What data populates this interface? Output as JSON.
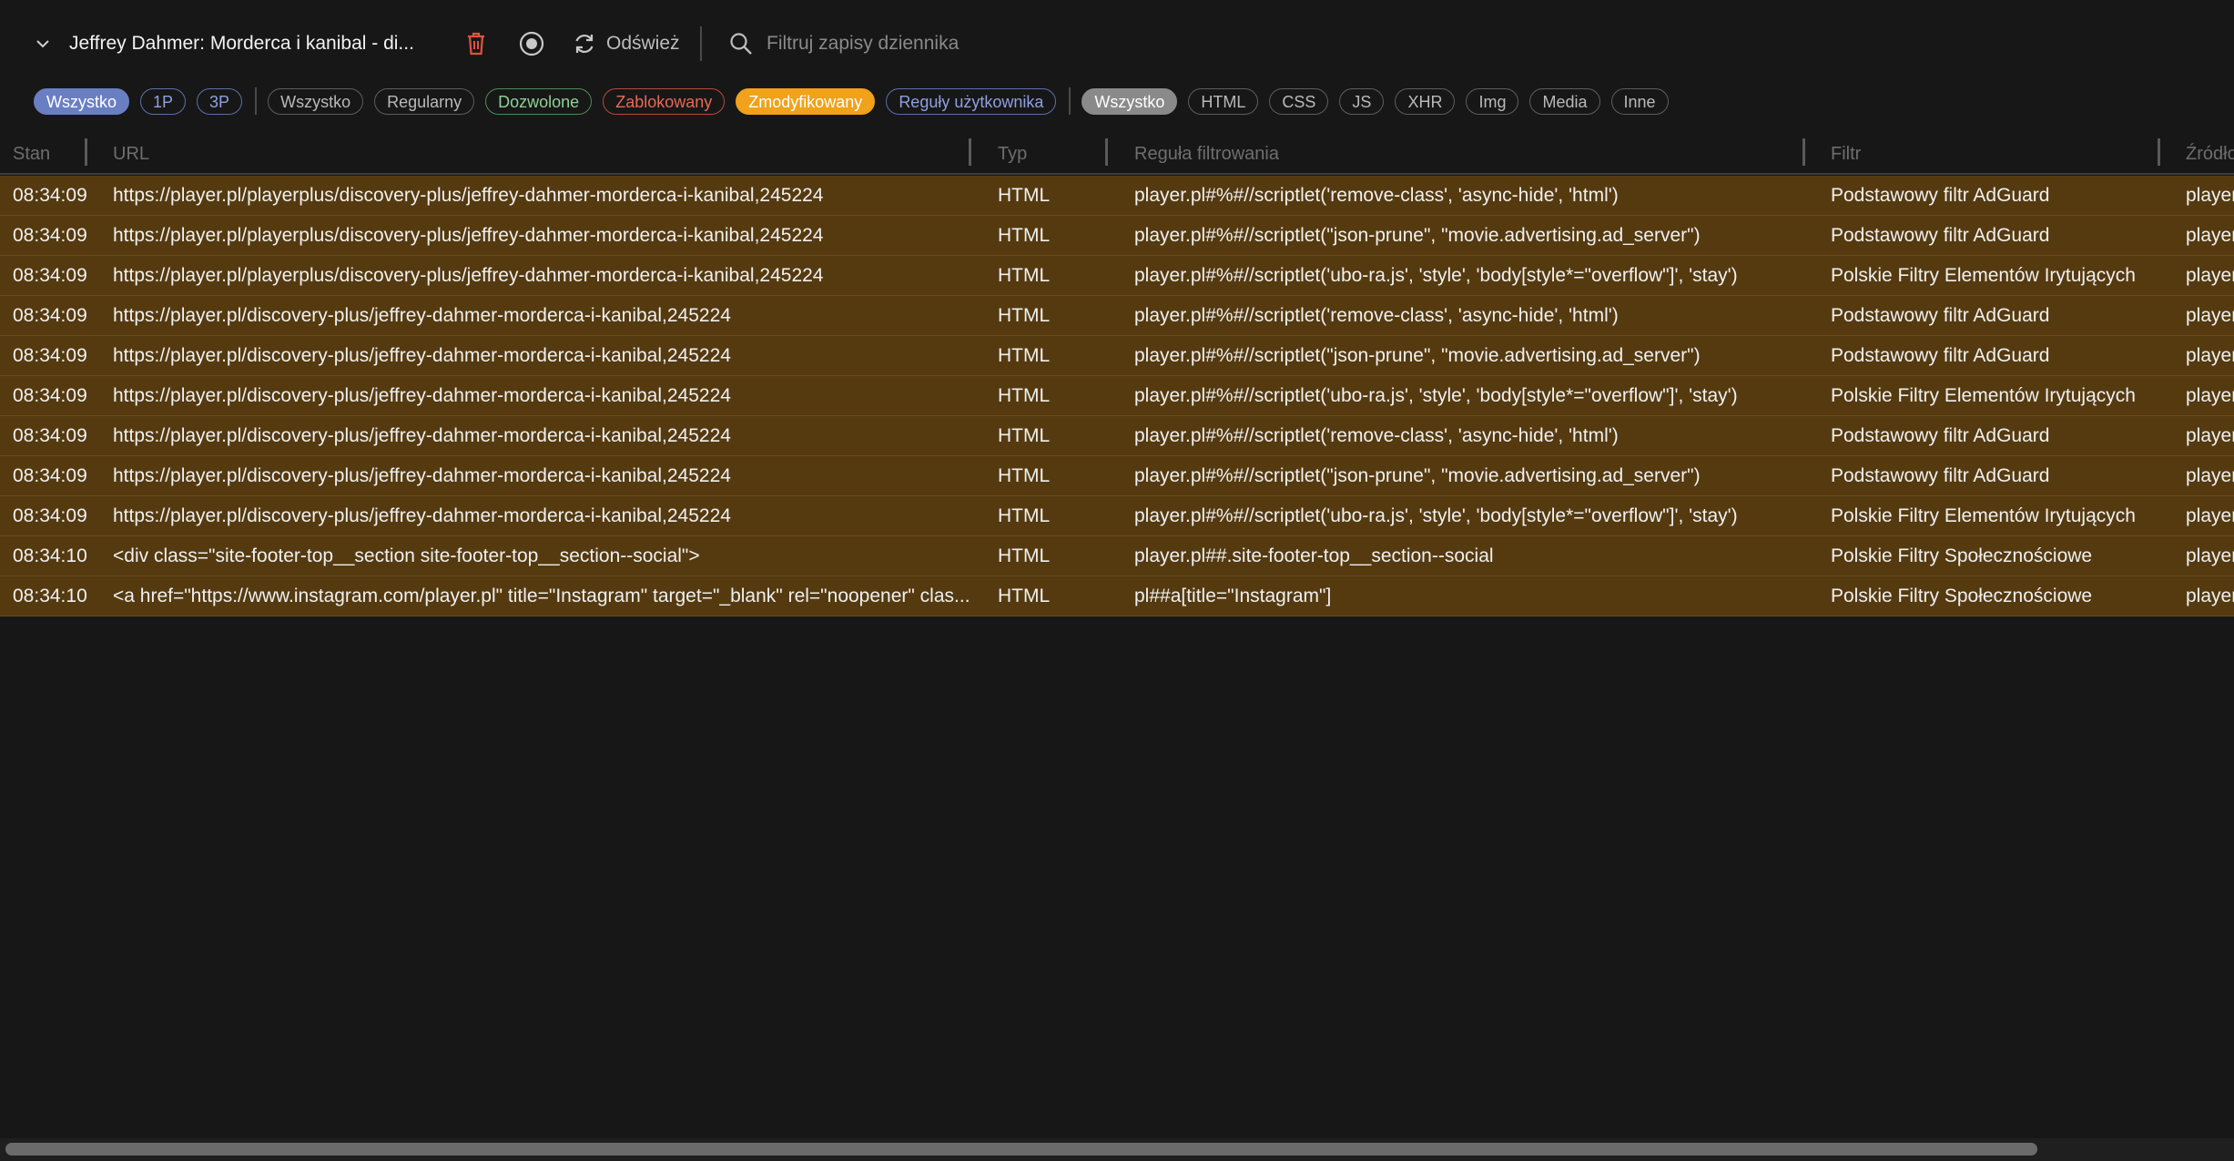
{
  "toolbar": {
    "tab_title": "Jeffrey Dahmer: Morderca i kanibal - di...",
    "refresh_label": "Odśwież",
    "search_placeholder": "Filtruj zapisy dziennika"
  },
  "chips": {
    "party": [
      {
        "label": "Wszystko",
        "active": true
      },
      {
        "label": "1P",
        "active": false
      },
      {
        "label": "3P",
        "active": false
      }
    ],
    "status": [
      {
        "label": "Wszystko",
        "active": false
      },
      {
        "label": "Regularny",
        "active": false
      },
      {
        "label": "Dozwolone",
        "active": false
      },
      {
        "label": "Zablokowany",
        "active": false
      },
      {
        "label": "Zmodyfikowany",
        "active": true
      },
      {
        "label": "Reguły użytkownika",
        "active": false
      }
    ],
    "type": [
      {
        "label": "Wszystko",
        "active": true
      },
      {
        "label": "HTML",
        "active": false
      },
      {
        "label": "CSS",
        "active": false
      },
      {
        "label": "JS",
        "active": false
      },
      {
        "label": "XHR",
        "active": false
      },
      {
        "label": "Img",
        "active": false
      },
      {
        "label": "Media",
        "active": false
      },
      {
        "label": "Inne",
        "active": false
      }
    ]
  },
  "table": {
    "headers": {
      "time": "Stan",
      "url": "URL",
      "type": "Typ",
      "rule": "Reguła filtrowania",
      "filter": "Filtr",
      "source": "Źródło"
    },
    "rows": [
      {
        "time": "08:34:09",
        "url": "https://player.pl/playerplus/discovery-plus/jeffrey-dahmer-morderca-i-kanibal,245224",
        "type": "HTML",
        "rule": "player.pl#%#//scriptlet('remove-class', 'async-hide', 'html')",
        "filter": "Podstawowy filtr AdGuard",
        "source": "player.pl"
      },
      {
        "time": "08:34:09",
        "url": "https://player.pl/playerplus/discovery-plus/jeffrey-dahmer-morderca-i-kanibal,245224",
        "type": "HTML",
        "rule": "player.pl#%#//scriptlet(\"json-prune\", \"movie.advertising.ad_server\")",
        "filter": "Podstawowy filtr AdGuard",
        "source": "player.pl"
      },
      {
        "time": "08:34:09",
        "url": "https://player.pl/playerplus/discovery-plus/jeffrey-dahmer-morderca-i-kanibal,245224",
        "type": "HTML",
        "rule": "player.pl#%#//scriptlet('ubo-ra.js', 'style', 'body[style*=\"overflow\"]', 'stay')",
        "filter": "Polskie Filtry Elementów Irytujących",
        "source": "player.pl"
      },
      {
        "time": "08:34:09",
        "url": "https://player.pl/discovery-plus/jeffrey-dahmer-morderca-i-kanibal,245224",
        "type": "HTML",
        "rule": "player.pl#%#//scriptlet('remove-class', 'async-hide', 'html')",
        "filter": "Podstawowy filtr AdGuard",
        "source": "player.pl"
      },
      {
        "time": "08:34:09",
        "url": "https://player.pl/discovery-plus/jeffrey-dahmer-morderca-i-kanibal,245224",
        "type": "HTML",
        "rule": "player.pl#%#//scriptlet(\"json-prune\", \"movie.advertising.ad_server\")",
        "filter": "Podstawowy filtr AdGuard",
        "source": "player.pl"
      },
      {
        "time": "08:34:09",
        "url": "https://player.pl/discovery-plus/jeffrey-dahmer-morderca-i-kanibal,245224",
        "type": "HTML",
        "rule": "player.pl#%#//scriptlet('ubo-ra.js', 'style', 'body[style*=\"overflow\"]', 'stay')",
        "filter": "Polskie Filtry Elementów Irytujących",
        "source": "player.pl"
      },
      {
        "time": "08:34:09",
        "url": "https://player.pl/discovery-plus/jeffrey-dahmer-morderca-i-kanibal,245224",
        "type": "HTML",
        "rule": "player.pl#%#//scriptlet('remove-class', 'async-hide', 'html')",
        "filter": "Podstawowy filtr AdGuard",
        "source": "player.pl"
      },
      {
        "time": "08:34:09",
        "url": "https://player.pl/discovery-plus/jeffrey-dahmer-morderca-i-kanibal,245224",
        "type": "HTML",
        "rule": "player.pl#%#//scriptlet(\"json-prune\", \"movie.advertising.ad_server\")",
        "filter": "Podstawowy filtr AdGuard",
        "source": "player.pl"
      },
      {
        "time": "08:34:09",
        "url": "https://player.pl/discovery-plus/jeffrey-dahmer-morderca-i-kanibal,245224",
        "type": "HTML",
        "rule": "player.pl#%#//scriptlet('ubo-ra.js', 'style', 'body[style*=\"overflow\"]', 'stay')",
        "filter": "Polskie Filtry Elementów Irytujących",
        "source": "player.pl"
      },
      {
        "time": "08:34:10",
        "url": "<div class=\"site-footer-top__section site-footer-top__section--social\">",
        "type": "HTML",
        "rule": "player.pl##.site-footer-top__section--social",
        "filter": "Polskie Filtry Społecznościowe",
        "source": "player.pl"
      },
      {
        "time": "08:34:10",
        "url": "<a href=\"https://www.instagram.com/player.pl\" title=\"Instagram\" target=\"_blank\" rel=\"noopener\" clas...",
        "type": "HTML",
        "rule": "pl##a[title=\"Instagram\"]",
        "filter": "Polskie Filtry Społecznościowe",
        "source": "player.pl"
      }
    ]
  },
  "colors": {
    "background": "#171717",
    "modified_row": "#553a10",
    "accent_blue": "#6a7fc2",
    "accent_orange": "#f0a21b",
    "trash_red": "#e0533e"
  },
  "icons": [
    "chevron-down-icon",
    "trash-icon",
    "record-icon",
    "refresh-icon",
    "search-icon"
  ],
  "scrollbar": {
    "horizontal_position": 0
  }
}
